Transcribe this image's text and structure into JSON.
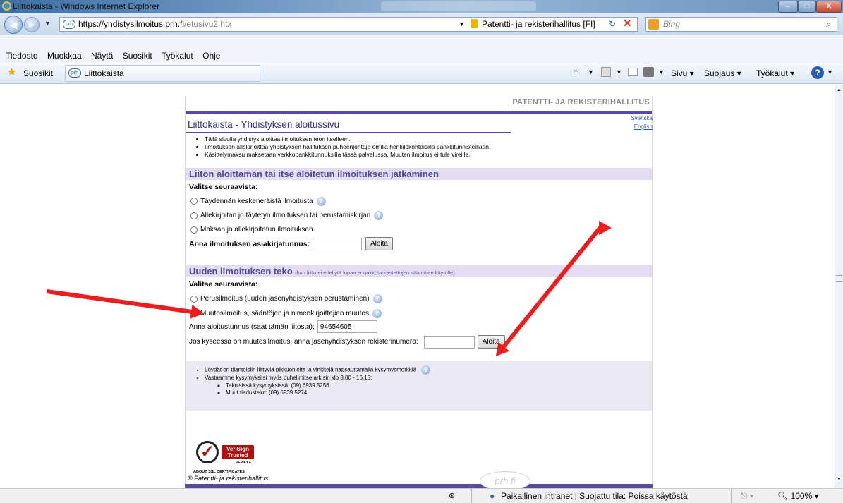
{
  "window": {
    "title": "Liittokaista - Windows Internet Explorer",
    "min": "–",
    "max": "□",
    "close": "X"
  },
  "address": {
    "url_main": "https://yhdistysilmoitus.prh.fi",
    "url_path": "/etusivu2.htx",
    "site": "Patentti- ja rekisterihallitus [FI]",
    "search_placeholder": "Bing"
  },
  "menu": [
    "Tiedosto",
    "Muokkaa",
    "Näytä",
    "Suosikit",
    "Työkalut",
    "Ohje"
  ],
  "favbar": {
    "favorites": "Suosikit",
    "tab": "Liittokaista",
    "sivu": "Sivu",
    "suojaus": "Suojaus",
    "tyokalut": "Työkalut"
  },
  "page": {
    "brand": "PATENTTI- JA REKISTERIHALLITUS",
    "title": "Liittokaista - Yhdistyksen aloitussivu",
    "langs": [
      "Svenska",
      "English"
    ],
    "intro": [
      "Tällä sivulla yhdistys aloittaa ilmoituksen teon itselleen.",
      "Ilmoituksen allekirjoittaa yhdistyksen hallituksen puheenjohtaja omilla henkilökohtaisilla pankkitunnisteillaan.",
      "Käsittelymaksu maksetaan verkkopankkitunnuksilla tässä palvelussa. Muuten ilmoitus ei tule vireille."
    ],
    "section1": {
      "heading": "Liiton aloittaman tai itse aloitetun ilmoituksen jatkaminen",
      "choose": "Valitse seuraavista:",
      "options": [
        "Täydennän keskeneräistä ilmoitusta",
        "Allekirjoitan jo täytetyn ilmoituksen tai perustamiskirjan",
        "Maksan jo allekirjoitetun ilmoituksen"
      ],
      "doc_label": "Anna ilmoituksen asiakirjatunnus:",
      "doc_value": "",
      "button": "Aloita"
    },
    "section2": {
      "heading": "Uuden ilmoituksen teko",
      "heading_note": "(kun liitto ei edellytä lupaa ennakkotarkastettujen sääntöjen käytölle)",
      "choose": "Valitse seuraavista:",
      "options": [
        "Perusilmoitus (uuden jäsenyhdistyksen perustaminen)",
        "Muutosilmoitus, sääntöjen ja nimenkirjoittajien muutos"
      ],
      "selected": 1,
      "start_label": "Anna aloitustunnus (saat tämän liitosta):",
      "start_value": "94654605",
      "reg_label": "Jos kyseessä on muutosilmoitus, anna jäsenyhdistyksen rekisterinumero:",
      "reg_value": "",
      "button": "Aloita"
    },
    "info": [
      "Löydät eri tilanteisiin liittyviä pikkuohjeita ja vinkkejä napsauttamalla kysymysmerkkiä",
      "Vastaamme kysymyksiisi myös puhelimitse arkisin klo 8.00 - 16.15:"
    ],
    "phones": [
      "Teknisissä kysymyksissä: (09) 6939 5256",
      "Muut tiedustelut: (09) 6939 5274"
    ],
    "verisign": {
      "line1": "VeriSign",
      "line2": "Trusted",
      "verify": "VERIFY ▸",
      "about": "ABOUT SSL CERTIFICATES"
    },
    "copyright": "© Patentti- ja rekisterihallitus",
    "prh": "prh.fi"
  },
  "status": {
    "zone": "Paikallinen intranet | Suojattu tila: Poissa käytöstä",
    "zoom": "100%"
  },
  "colors": {
    "accent": "#5a4aa5",
    "section_bg": "#e4dcf3",
    "arrow": "#ee1c1c"
  }
}
